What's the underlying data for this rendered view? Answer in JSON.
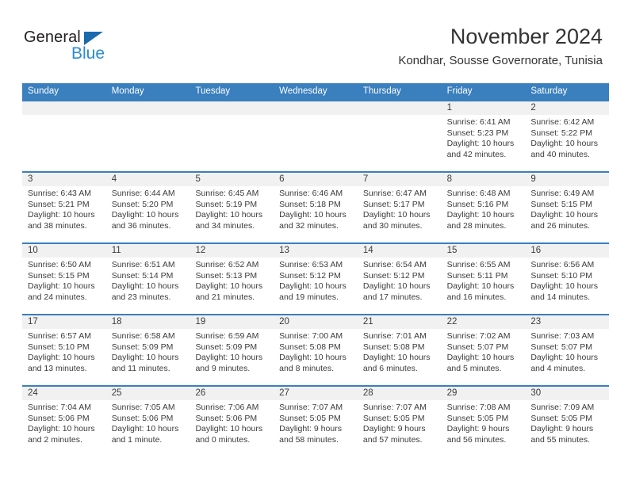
{
  "logo": {
    "word1": "General",
    "word2": "Blue",
    "triangle_icon": "triangle-icon",
    "color_dark": "#231f20",
    "color_blue": "#2a8bd5",
    "color_triangle": "#1b6aad"
  },
  "header": {
    "title": "November 2024",
    "subtitle": "Kondhar, Sousse Governorate, Tunisia"
  },
  "theme": {
    "header_blue": "#3a7fbe",
    "daynum_gray": "#f1f1f1",
    "text": "#3b3b3b"
  },
  "weekdays": [
    "Sunday",
    "Monday",
    "Tuesday",
    "Wednesday",
    "Thursday",
    "Friday",
    "Saturday"
  ],
  "weeks": [
    [
      {
        "day": "",
        "sunrise": "",
        "sunset": "",
        "daylight1": "",
        "daylight2": "",
        "empty": true
      },
      {
        "day": "",
        "sunrise": "",
        "sunset": "",
        "daylight1": "",
        "daylight2": "",
        "empty": true
      },
      {
        "day": "",
        "sunrise": "",
        "sunset": "",
        "daylight1": "",
        "daylight2": "",
        "empty": true
      },
      {
        "day": "",
        "sunrise": "",
        "sunset": "",
        "daylight1": "",
        "daylight2": "",
        "empty": true
      },
      {
        "day": "",
        "sunrise": "",
        "sunset": "",
        "daylight1": "",
        "daylight2": "",
        "empty": true
      },
      {
        "day": "1",
        "sunrise": "Sunrise: 6:41 AM",
        "sunset": "Sunset: 5:23 PM",
        "daylight1": "Daylight: 10 hours",
        "daylight2": "and 42 minutes.",
        "empty": false
      },
      {
        "day": "2",
        "sunrise": "Sunrise: 6:42 AM",
        "sunset": "Sunset: 5:22 PM",
        "daylight1": "Daylight: 10 hours",
        "daylight2": "and 40 minutes.",
        "empty": false
      }
    ],
    [
      {
        "day": "3",
        "sunrise": "Sunrise: 6:43 AM",
        "sunset": "Sunset: 5:21 PM",
        "daylight1": "Daylight: 10 hours",
        "daylight2": "and 38 minutes.",
        "empty": false
      },
      {
        "day": "4",
        "sunrise": "Sunrise: 6:44 AM",
        "sunset": "Sunset: 5:20 PM",
        "daylight1": "Daylight: 10 hours",
        "daylight2": "and 36 minutes.",
        "empty": false
      },
      {
        "day": "5",
        "sunrise": "Sunrise: 6:45 AM",
        "sunset": "Sunset: 5:19 PM",
        "daylight1": "Daylight: 10 hours",
        "daylight2": "and 34 minutes.",
        "empty": false
      },
      {
        "day": "6",
        "sunrise": "Sunrise: 6:46 AM",
        "sunset": "Sunset: 5:18 PM",
        "daylight1": "Daylight: 10 hours",
        "daylight2": "and 32 minutes.",
        "empty": false
      },
      {
        "day": "7",
        "sunrise": "Sunrise: 6:47 AM",
        "sunset": "Sunset: 5:17 PM",
        "daylight1": "Daylight: 10 hours",
        "daylight2": "and 30 minutes.",
        "empty": false
      },
      {
        "day": "8",
        "sunrise": "Sunrise: 6:48 AM",
        "sunset": "Sunset: 5:16 PM",
        "daylight1": "Daylight: 10 hours",
        "daylight2": "and 28 minutes.",
        "empty": false
      },
      {
        "day": "9",
        "sunrise": "Sunrise: 6:49 AM",
        "sunset": "Sunset: 5:15 PM",
        "daylight1": "Daylight: 10 hours",
        "daylight2": "and 26 minutes.",
        "empty": false
      }
    ],
    [
      {
        "day": "10",
        "sunrise": "Sunrise: 6:50 AM",
        "sunset": "Sunset: 5:15 PM",
        "daylight1": "Daylight: 10 hours",
        "daylight2": "and 24 minutes.",
        "empty": false
      },
      {
        "day": "11",
        "sunrise": "Sunrise: 6:51 AM",
        "sunset": "Sunset: 5:14 PM",
        "daylight1": "Daylight: 10 hours",
        "daylight2": "and 23 minutes.",
        "empty": false
      },
      {
        "day": "12",
        "sunrise": "Sunrise: 6:52 AM",
        "sunset": "Sunset: 5:13 PM",
        "daylight1": "Daylight: 10 hours",
        "daylight2": "and 21 minutes.",
        "empty": false
      },
      {
        "day": "13",
        "sunrise": "Sunrise: 6:53 AM",
        "sunset": "Sunset: 5:12 PM",
        "daylight1": "Daylight: 10 hours",
        "daylight2": "and 19 minutes.",
        "empty": false
      },
      {
        "day": "14",
        "sunrise": "Sunrise: 6:54 AM",
        "sunset": "Sunset: 5:12 PM",
        "daylight1": "Daylight: 10 hours",
        "daylight2": "and 17 minutes.",
        "empty": false
      },
      {
        "day": "15",
        "sunrise": "Sunrise: 6:55 AM",
        "sunset": "Sunset: 5:11 PM",
        "daylight1": "Daylight: 10 hours",
        "daylight2": "and 16 minutes.",
        "empty": false
      },
      {
        "day": "16",
        "sunrise": "Sunrise: 6:56 AM",
        "sunset": "Sunset: 5:10 PM",
        "daylight1": "Daylight: 10 hours",
        "daylight2": "and 14 minutes.",
        "empty": false
      }
    ],
    [
      {
        "day": "17",
        "sunrise": "Sunrise: 6:57 AM",
        "sunset": "Sunset: 5:10 PM",
        "daylight1": "Daylight: 10 hours",
        "daylight2": "and 13 minutes.",
        "empty": false
      },
      {
        "day": "18",
        "sunrise": "Sunrise: 6:58 AM",
        "sunset": "Sunset: 5:09 PM",
        "daylight1": "Daylight: 10 hours",
        "daylight2": "and 11 minutes.",
        "empty": false
      },
      {
        "day": "19",
        "sunrise": "Sunrise: 6:59 AM",
        "sunset": "Sunset: 5:09 PM",
        "daylight1": "Daylight: 10 hours",
        "daylight2": "and 9 minutes.",
        "empty": false
      },
      {
        "day": "20",
        "sunrise": "Sunrise: 7:00 AM",
        "sunset": "Sunset: 5:08 PM",
        "daylight1": "Daylight: 10 hours",
        "daylight2": "and 8 minutes.",
        "empty": false
      },
      {
        "day": "21",
        "sunrise": "Sunrise: 7:01 AM",
        "sunset": "Sunset: 5:08 PM",
        "daylight1": "Daylight: 10 hours",
        "daylight2": "and 6 minutes.",
        "empty": false
      },
      {
        "day": "22",
        "sunrise": "Sunrise: 7:02 AM",
        "sunset": "Sunset: 5:07 PM",
        "daylight1": "Daylight: 10 hours",
        "daylight2": "and 5 minutes.",
        "empty": false
      },
      {
        "day": "23",
        "sunrise": "Sunrise: 7:03 AM",
        "sunset": "Sunset: 5:07 PM",
        "daylight1": "Daylight: 10 hours",
        "daylight2": "and 4 minutes.",
        "empty": false
      }
    ],
    [
      {
        "day": "24",
        "sunrise": "Sunrise: 7:04 AM",
        "sunset": "Sunset: 5:06 PM",
        "daylight1": "Daylight: 10 hours",
        "daylight2": "and 2 minutes.",
        "empty": false
      },
      {
        "day": "25",
        "sunrise": "Sunrise: 7:05 AM",
        "sunset": "Sunset: 5:06 PM",
        "daylight1": "Daylight: 10 hours",
        "daylight2": "and 1 minute.",
        "empty": false
      },
      {
        "day": "26",
        "sunrise": "Sunrise: 7:06 AM",
        "sunset": "Sunset: 5:06 PM",
        "daylight1": "Daylight: 10 hours",
        "daylight2": "and 0 minutes.",
        "empty": false
      },
      {
        "day": "27",
        "sunrise": "Sunrise: 7:07 AM",
        "sunset": "Sunset: 5:05 PM",
        "daylight1": "Daylight: 9 hours",
        "daylight2": "and 58 minutes.",
        "empty": false
      },
      {
        "day": "28",
        "sunrise": "Sunrise: 7:07 AM",
        "sunset": "Sunset: 5:05 PM",
        "daylight1": "Daylight: 9 hours",
        "daylight2": "and 57 minutes.",
        "empty": false
      },
      {
        "day": "29",
        "sunrise": "Sunrise: 7:08 AM",
        "sunset": "Sunset: 5:05 PM",
        "daylight1": "Daylight: 9 hours",
        "daylight2": "and 56 minutes.",
        "empty": false
      },
      {
        "day": "30",
        "sunrise": "Sunrise: 7:09 AM",
        "sunset": "Sunset: 5:05 PM",
        "daylight1": "Daylight: 9 hours",
        "daylight2": "and 55 minutes.",
        "empty": false
      }
    ]
  ]
}
